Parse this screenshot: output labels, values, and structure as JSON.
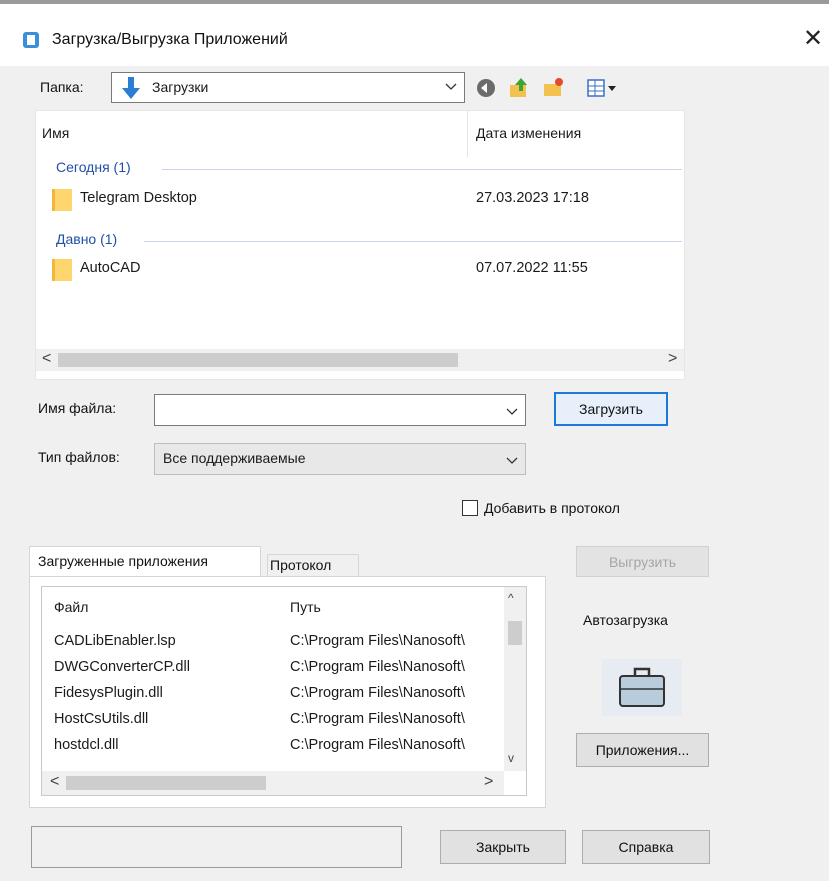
{
  "window": {
    "title": "Загрузка/Выгрузка Приложений",
    "close_glyph": "✕"
  },
  "folder": {
    "label": "Папка:",
    "value": "Загрузки",
    "icons": [
      "back-icon",
      "up-folder-icon",
      "new-folder-icon",
      "view-menu-icon"
    ]
  },
  "file_list": {
    "columns": [
      "Имя",
      "Дата изменения"
    ],
    "groups": [
      {
        "header": "Сегодня (1)",
        "items": [
          {
            "name": "Telegram Desktop",
            "date": "27.03.2023 17:18"
          }
        ]
      },
      {
        "header": "Давно (1)",
        "items": [
          {
            "name": "AutoCAD",
            "date": "07.07.2022 11:55"
          }
        ]
      }
    ],
    "scroll_left": "<",
    "scroll_right": ">"
  },
  "filename": {
    "label": "Имя файла:",
    "value": "",
    "load_button": "Загрузить"
  },
  "filetype": {
    "label": "Тип файлов:",
    "value": "Все поддерживаемые"
  },
  "add_to_log": {
    "label": "Добавить в протокол",
    "checked": false
  },
  "tabs": [
    {
      "label": "Загруженные приложения",
      "active": true
    },
    {
      "label": "Протокол",
      "active": false
    }
  ],
  "unload_button": "Выгрузить",
  "apps_list": {
    "columns": [
      "Файл",
      "Путь"
    ],
    "rows": [
      {
        "file": "CADLibEnabler.lsp",
        "path": "C:\\Program Files\\Nanosoft\\"
      },
      {
        "file": "DWGConverterCP.dll",
        "path": "C:\\Program Files\\Nanosoft\\"
      },
      {
        "file": "FidesysPlugin.dll",
        "path": "C:\\Program Files\\Nanosoft\\"
      },
      {
        "file": "HostCsUtils.dll",
        "path": "C:\\Program Files\\Nanosoft\\"
      },
      {
        "file": "hostdcl.dll",
        "path": "C:\\Program Files\\Nanosoft\\"
      }
    ],
    "scroll_left": "<",
    "scroll_right": ">",
    "scroll_up": "^",
    "scroll_down": "v"
  },
  "autoload": {
    "label": "Автозагрузка",
    "icon": "briefcase-icon",
    "button": "Приложения..."
  },
  "footer": {
    "status": "",
    "close_button": "Закрыть",
    "help_button": "Справка"
  },
  "colors": {
    "dialog_bg": "#f0f0f0",
    "group_header": "#1f4fa8",
    "primary_border": "#1e78d6",
    "folder_yellow": "#ffd66e"
  }
}
